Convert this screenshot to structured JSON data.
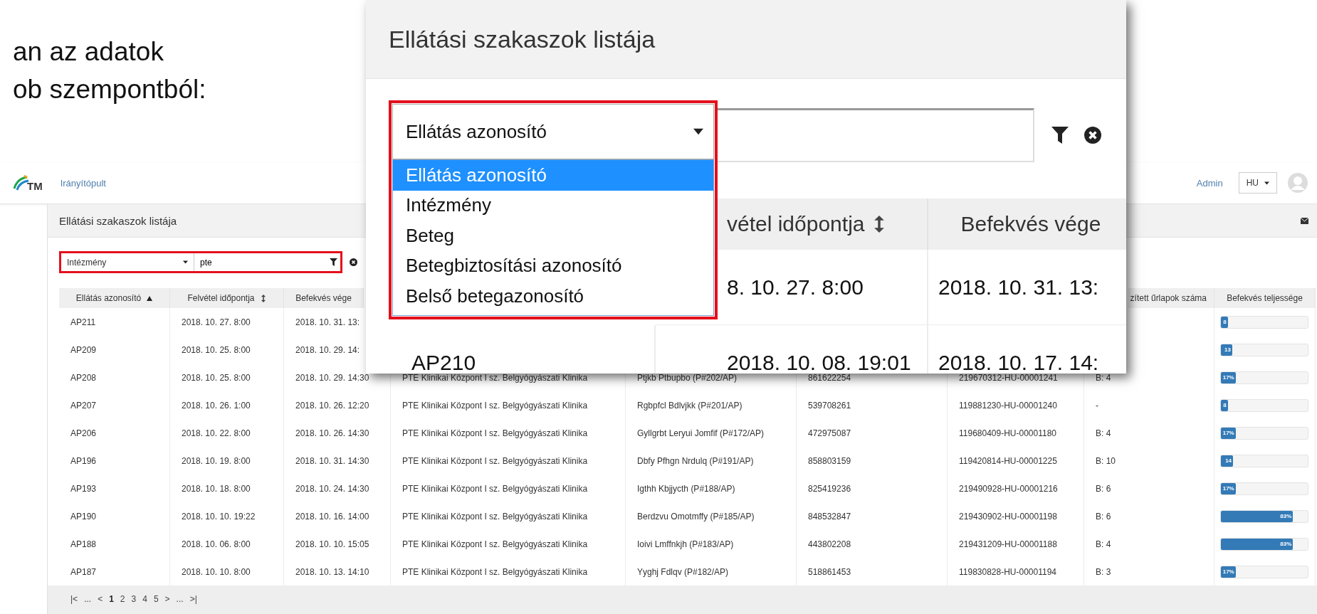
{
  "slide_text": [
    "an az adatok",
    "ob szempontból:"
  ],
  "topbar": {
    "logo_text": "TM",
    "nav_link": "Irányítópult",
    "user_link": "Admin",
    "language": "HU"
  },
  "panel": {
    "title": "Ellátási szakaszok listája",
    "filter": {
      "field": "Intézmény",
      "value": "pte"
    },
    "columns": {
      "column_1": {
        "label": "Ellátás azonosító",
        "sorted_ascending": true
      },
      "column_2": {
        "label": "Felvétel időpontja",
        "sortable": true
      },
      "column_3": {
        "label": "Befekvés vége"
      },
      "column_8": {
        "label": "zített űrlapok száma"
      },
      "column_9": {
        "label": "Befekvés teljessége"
      }
    },
    "rows": [
      {
        "column_1": "AP211",
        "column_2": "2018. 10. 27. 8:00",
        "column_3": "2018. 10. 31. 13:",
        "column_9": {
          "level": 0.08,
          "label": "8"
        }
      },
      {
        "column_1": "AP209",
        "column_2": "2018. 10. 25. 8:00",
        "column_3": "2018. 10. 29. 14:",
        "column_9": {
          "level": 0.13,
          "label": "13"
        }
      },
      {
        "column_1": "AP208",
        "column_2": "2018. 10. 25. 8:00",
        "column_3": "2018. 10. 29. 14:30",
        "column_4": "PTE Klinikai Központ I sz. Belgyógyászati Klinika",
        "column_5": "Ptjkb Ptbupbo (P#202/AP)",
        "column_6": "861622254",
        "column_7": "219670312-HU-00001241",
        "column_8": "B: 4",
        "column_9": {
          "level": 0.17,
          "label": "17%"
        }
      },
      {
        "column_1": "AP207",
        "column_2": "2018. 10. 26. 1:00",
        "column_3": "2018. 10. 26. 12:20",
        "column_4": "PTE Klinikai Központ I sz. Belgyógyászati Klinika",
        "column_5": "Rgbpfcl Bdlvjkk (P#201/AP)",
        "column_6": "539708261",
        "column_7": "119881230-HU-00001240",
        "column_8": "-",
        "column_9": {
          "level": 0.08,
          "label": "8"
        }
      },
      {
        "column_1": "AP206",
        "column_2": "2018. 10. 22. 8:00",
        "column_3": "2018. 10. 26. 14:30",
        "column_4": "PTE Klinikai Központ I sz. Belgyógyászati Klinika",
        "column_5": "Gyllgrbt Leryui Jomfif (P#172/AP)",
        "column_6": "472975087",
        "column_7": "119680409-HU-00001180",
        "column_8": "B: 4",
        "column_9": {
          "level": 0.17,
          "label": "17%"
        }
      },
      {
        "column_1": "AP196",
        "column_2": "2018. 10. 19. 8:00",
        "column_3": "2018. 10. 31. 14:30",
        "column_4": "PTE Klinikai Központ I sz. Belgyógyászati Klinika",
        "column_5": "Dbfy Pfhgn Nrdulq (P#191/AP)",
        "column_6": "858803159",
        "column_7": "119420814-HU-00001225",
        "column_8": "B: 10",
        "column_9": {
          "level": 0.14,
          "label": "14"
        }
      },
      {
        "column_1": "AP193",
        "column_2": "2018. 10. 18. 8:00",
        "column_3": "2018. 10. 24. 14:30",
        "column_4": "PTE Klinikai Központ I sz. Belgyógyászati Klinika",
        "column_5": "Igthh Kbjjycth (P#188/AP)",
        "column_6": "825419236",
        "column_7": "219490928-HU-00001216",
        "column_8": "B: 6",
        "column_9": {
          "level": 0.17,
          "label": "17%"
        }
      },
      {
        "column_1": "AP190",
        "column_2": "2018. 10. 10. 19:22",
        "column_3": "2018. 10. 16. 14:00",
        "column_4": "PTE Klinikai Központ I sz. Belgyógyászati Klinika",
        "column_5": "Berdzvu Omotmffy (P#185/AP)",
        "column_6": "848532847",
        "column_7": "219430902-HU-00001198",
        "column_8": "B: 6",
        "column_9": {
          "level": 0.83,
          "label": "83%"
        }
      },
      {
        "column_1": "AP188",
        "column_2": "2018. 10. 06. 8:00",
        "column_3": "2018. 10. 10. 15:05",
        "column_4": "PTE Klinikai Központ I sz. Belgyógyászati Klinika",
        "column_5": "Ioivi Lmffnkjh (P#183/AP)",
        "column_6": "443802208",
        "column_7": "219431209-HU-00001188",
        "column_8": "B: 4",
        "column_9": {
          "level": 0.83,
          "label": "83%"
        }
      },
      {
        "column_1": "AP187",
        "column_2": "2018. 10. 10. 8:00",
        "column_3": "2018. 10. 13. 14:10",
        "column_4": "PTE Klinikai Központ I sz. Belgyógyászati Klinika",
        "column_5": "Yyghj Fdlqv (P#182/AP)",
        "column_6": "518861453",
        "column_7": "119830828-HU-00001194",
        "column_8": "B: 3",
        "column_9": {
          "level": 0.17,
          "label": "17%"
        }
      }
    ],
    "pagination": [
      {
        "label": "|<",
        "selected": false
      },
      {
        "label": "...",
        "selected": false
      },
      {
        "label": "<",
        "selected": false
      },
      {
        "label": "1",
        "selected": true
      },
      {
        "label": "2",
        "selected": false
      },
      {
        "label": "3",
        "selected": false
      },
      {
        "label": "4",
        "selected": false
      },
      {
        "label": "5",
        "selected": false
      },
      {
        "label": ">",
        "selected": false
      },
      {
        "label": "...",
        "selected": false
      },
      {
        "label": ">|",
        "selected": false
      }
    ]
  },
  "callout": {
    "title": "Ellátási szakaszok listája",
    "filter": {
      "field": "Ellátás azonosító",
      "options": [
        {
          "label": "Ellátás azonosító",
          "selected": true
        },
        {
          "label": "Intézmény",
          "selected": false
        },
        {
          "label": "Beteg",
          "selected": false
        },
        {
          "label": "Betegbiztosítási azonosító",
          "selected": false
        },
        {
          "label": "Belső betegazonosító",
          "selected": false
        }
      ]
    },
    "columns": {
      "column_2": {
        "label": "vétel időpontja",
        "sortable": true
      },
      "column_3": {
        "label": "Befekvés vége"
      }
    },
    "rows": [
      {
        "column_2": "8. 10. 27. 8:00",
        "column_3": "2018. 10. 31. 13:"
      },
      {
        "column_1": "AP210",
        "column_2": "2018. 10. 08. 19:01",
        "column_3": "2018. 10. 17. 14:"
      }
    ]
  }
}
